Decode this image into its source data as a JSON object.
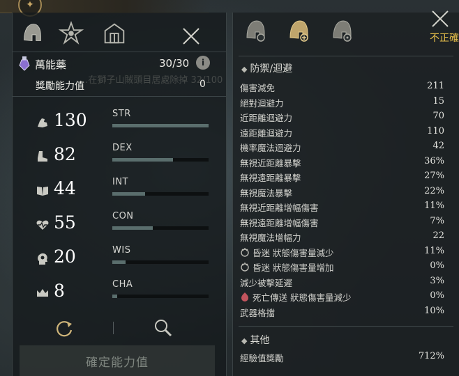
{
  "left": {
    "item": {
      "name": "萬能藥",
      "count": "30/30",
      "info": "i"
    },
    "ghost_text": "...在獅子山賊頭目居處除掉 32/100",
    "bonus": {
      "label": "獎勵能力值",
      "value": "0"
    },
    "stats": [
      {
        "abbr": "STR",
        "value": "130",
        "icon": "strength-arm-icon",
        "fill": 1.0
      },
      {
        "abbr": "DEX",
        "value": "82",
        "icon": "boot-icon",
        "fill": 0.63
      },
      {
        "abbr": "INT",
        "value": "44",
        "icon": "book-icon",
        "fill": 0.34
      },
      {
        "abbr": "CON",
        "value": "55",
        "icon": "heart-icon",
        "fill": 0.42
      },
      {
        "abbr": "WIS",
        "value": "20",
        "icon": "head-icon",
        "fill": 0.14
      },
      {
        "abbr": "CHA",
        "value": "8",
        "icon": "crown-icon",
        "fill": 0.05
      }
    ],
    "confirm_label": "確定能力值"
  },
  "right": {
    "close_label": "不正確",
    "defense_title": "防禦/迴避",
    "defense": [
      {
        "label": "傷害減免",
        "value": "211"
      },
      {
        "label": "絕對迴避力",
        "value": "15"
      },
      {
        "label": "近距離迴避力",
        "value": "70"
      },
      {
        "label": "遠距離迴避力",
        "value": "110"
      },
      {
        "label": "機率魔法迴避力",
        "value": "42"
      },
      {
        "label": "無視近距離暴擊",
        "value": "36%"
      },
      {
        "label": "無視遠距離暴擊",
        "value": "27%"
      },
      {
        "label": "無視魔法暴擊",
        "value": "22%"
      },
      {
        "label": "無視近距離增幅傷害",
        "value": "11%"
      },
      {
        "label": "無視遠距離增幅傷害",
        "value": "7%"
      },
      {
        "label": "無視魔法增幅力",
        "value": "22"
      },
      {
        "label": "昏迷 狀態傷害量減少",
        "value": "11%",
        "icon": "stun-icon"
      },
      {
        "label": "昏迷 狀態傷害量增加",
        "value": "0%",
        "icon": "stun-icon"
      },
      {
        "label": "減少被擊延遲",
        "value": "3%"
      },
      {
        "label": "死亡傳送 狀態傷害量減少",
        "value": "0%",
        "icon": "death-teleport-icon"
      },
      {
        "label": "武器格擋",
        "value": "10%"
      }
    ],
    "other_title": "其他",
    "other": [
      {
        "label": "經驗值獎勵",
        "value": "712%"
      }
    ]
  },
  "colors": {
    "accent": "#e8c04a",
    "bar_fill": "#5a6e6d",
    "panel": "#1c2123"
  }
}
